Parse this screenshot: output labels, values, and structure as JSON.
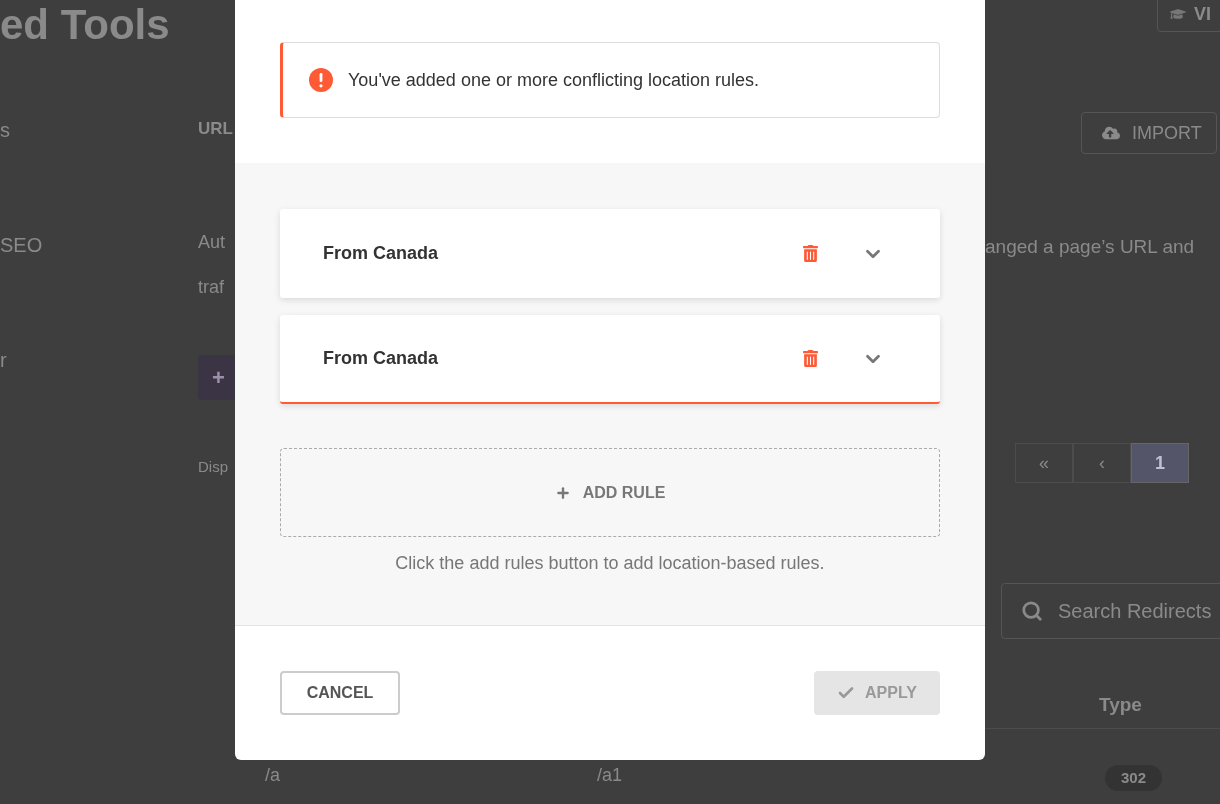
{
  "background": {
    "page_title": "ed Tools",
    "sidebar_items": [
      "s",
      "SEO",
      "r"
    ],
    "section_title": "URL",
    "description_lines": [
      "Aut",
      "traf"
    ],
    "add_button": {
      "label": "+"
    },
    "display_label": "Disp",
    "tutorial_button": {
      "label": "VI"
    },
    "import_button": {
      "label": "IMPORT"
    },
    "description_right": "anged a page’s URL and",
    "pagination": [
      {
        "label": "«",
        "selected": false
      },
      {
        "label": "‹",
        "selected": false
      },
      {
        "label": "1",
        "selected": true
      }
    ],
    "search": {
      "placeholder": "Search Redirects"
    },
    "table": {
      "column_header": "Type",
      "row": {
        "source": "/a",
        "target": "/a1",
        "type": "302"
      }
    }
  },
  "modal": {
    "alert": {
      "kind": "error",
      "message": "You've added one or more conflicting location rules."
    },
    "rules": [
      {
        "label": "From Canada",
        "conflict": false,
        "expanded": false
      },
      {
        "label": "From Canada",
        "conflict": true,
        "expanded": false
      }
    ],
    "add_rule": {
      "label": "ADD RULE"
    },
    "hint": "Click the add rules button to add location-based rules.",
    "cancel": {
      "label": "CANCEL"
    },
    "apply": {
      "label": "APPLY",
      "disabled": true
    }
  }
}
